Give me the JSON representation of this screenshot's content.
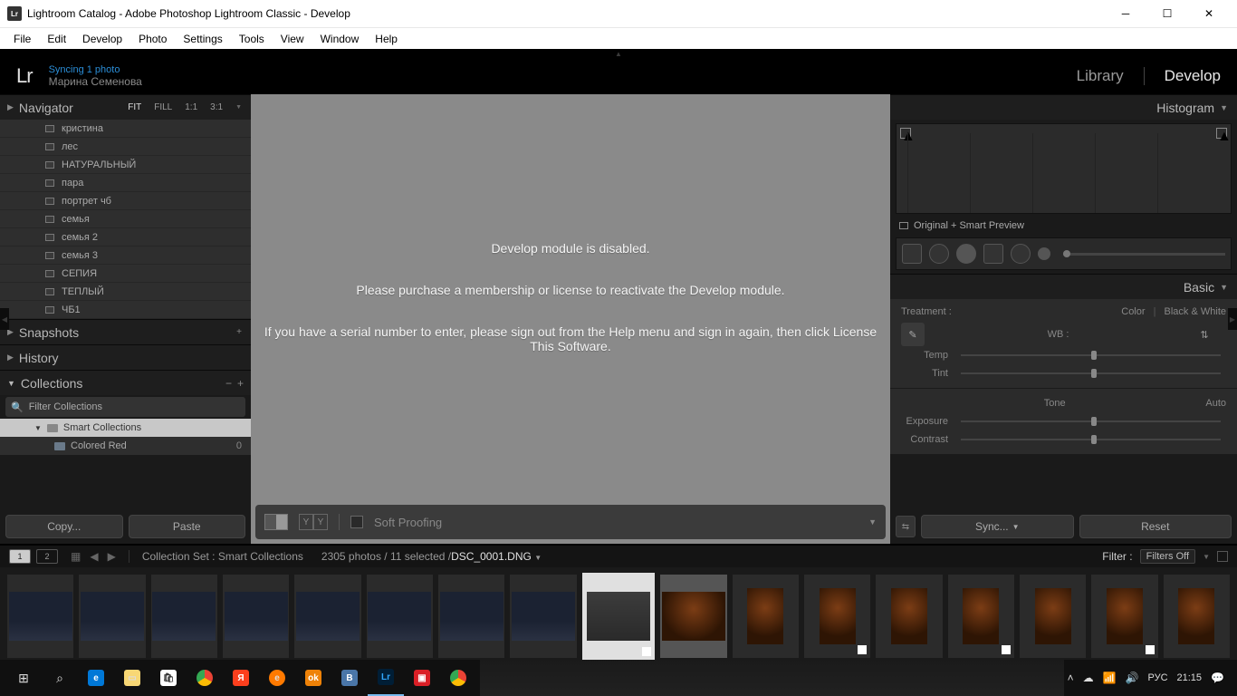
{
  "window": {
    "title": "Lightroom Catalog - Adobe Photoshop Lightroom Classic - Develop"
  },
  "menubar": [
    "File",
    "Edit",
    "Develop",
    "Photo",
    "Settings",
    "Tools",
    "View",
    "Window",
    "Help"
  ],
  "identity": {
    "mark": "Lr",
    "sync": "Syncing 1 photo",
    "user": "Марина Семенова",
    "modules": {
      "library": "Library",
      "develop": "Develop"
    }
  },
  "left": {
    "navigator": {
      "title": "Navigator",
      "zoom": [
        "FIT",
        "FILL",
        "1:1",
        "3:1"
      ]
    },
    "folders": [
      "кристина",
      "лес",
      "НАТУРАЛЬНЫЙ",
      "пара",
      "портрет чб",
      "семья",
      "семья 2",
      "семья 3",
      "СЕПИЯ",
      "ТЕПЛЫЙ",
      "ЧБ1"
    ],
    "snapshots": "Snapshots",
    "history": "History",
    "collections": {
      "title": "Collections",
      "filter_placeholder": "Filter Collections",
      "smart": "Smart Collections",
      "child": {
        "name": "Colored Red",
        "count": "0"
      }
    },
    "buttons": {
      "copy": "Copy...",
      "paste": "Paste"
    }
  },
  "center": {
    "line1": "Develop module is disabled.",
    "line2": "Please purchase a membership or license to reactivate the Develop module.",
    "line3": "If you have a serial number to enter, please sign out from the Help menu and sign in again, then click License This Software.",
    "softproof": "Soft Proofing"
  },
  "right": {
    "histogram": "Histogram",
    "orig": "Original + Smart Preview",
    "basic": {
      "title": "Basic",
      "treatment": "Treatment :",
      "color": "Color",
      "bw": "Black & White",
      "wb": "WB :",
      "temp": "Temp",
      "tint": "Tint",
      "tone": "Tone",
      "auto": "Auto",
      "exposure": "Exposure",
      "contrast": "Contrast"
    },
    "sync": "Sync...",
    "reset": "Reset"
  },
  "secbar": {
    "collection": "Collection Set : Smart Collections",
    "count": "2305 photos / 11 selected /",
    "filename": "DSC_0001.DNG",
    "filter_label": "Filter :",
    "filter_value": "Filters Off"
  },
  "taskbar": {
    "lang": "РУС",
    "time": "21:15"
  }
}
